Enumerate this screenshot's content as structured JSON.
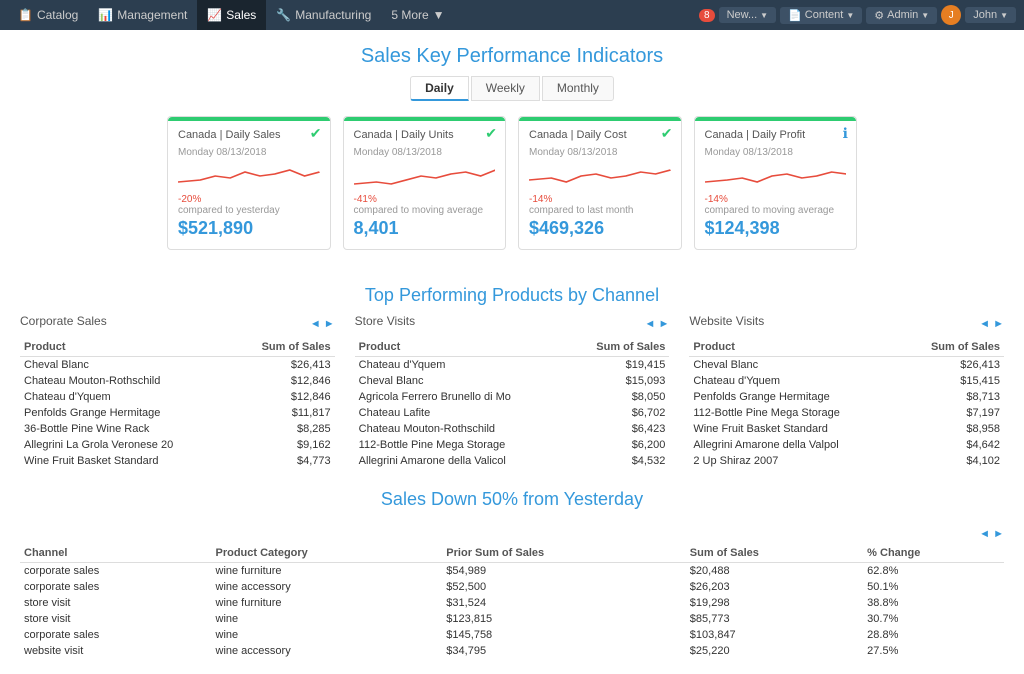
{
  "nav": {
    "items": [
      {
        "label": "Catalog",
        "icon": "📋",
        "active": false
      },
      {
        "label": "Management",
        "icon": "📊",
        "active": false
      },
      {
        "label": "Sales",
        "icon": "📈",
        "active": true
      },
      {
        "label": "Manufacturing",
        "icon": "🔧",
        "active": false
      },
      {
        "label": "5 More",
        "icon": "",
        "active": false
      }
    ],
    "right": {
      "badge": "8",
      "new_label": "New...",
      "content_label": "Content",
      "admin_label": "Admin",
      "user_label": "John"
    }
  },
  "kpi": {
    "title": "Sales Key Performance Indicators",
    "tabs": [
      "Daily",
      "Weekly",
      "Monthly"
    ],
    "active_tab": "Daily",
    "cards": [
      {
        "bar_color": "green",
        "status": "green",
        "label": "Canada | Daily Sales",
        "date": "Monday 08/13/2018",
        "change": "-20%",
        "change_label": "compared to yesterday",
        "value": "$521,890"
      },
      {
        "bar_color": "green",
        "status": "green",
        "label": "Canada | Daily Units",
        "date": "Monday 08/13/2018",
        "change": "-41%",
        "change_label": "compared to moving average",
        "value": "8,401"
      },
      {
        "bar_color": "green",
        "status": "green",
        "label": "Canada | Daily Cost",
        "date": "Monday 08/13/2018",
        "change": "-14%",
        "change_label": "compared to last month",
        "value": "$469,326"
      },
      {
        "bar_color": "green",
        "status": "info",
        "label": "Canada | Daily Profit",
        "date": "Monday 08/13/2018",
        "change": "-14%",
        "change_label": "compared to moving average",
        "value": "$124,398"
      }
    ]
  },
  "top_products": {
    "title": "Top Performing Products by Channel",
    "tables": [
      {
        "channel": "Corporate Sales",
        "col1": "Product",
        "col2": "Sum of Sales",
        "rows": [
          [
            "Cheval Blanc",
            "$26,413"
          ],
          [
            "Chateau Mouton-Rothschild",
            "$12,846"
          ],
          [
            "Chateau d'Yquem",
            "$12,846"
          ],
          [
            "Penfolds Grange Hermitage",
            "$11,817"
          ],
          [
            "36-Bottle Pine Wine Rack",
            "$8,285"
          ],
          [
            "Allegrini La Grola Veronese 20",
            "$9,162"
          ],
          [
            "Wine Fruit Basket Standard",
            "$4,773"
          ]
        ]
      },
      {
        "channel": "Store Visits",
        "col1": "Product",
        "col2": "Sum of Sales",
        "rows": [
          [
            "Chateau d'Yquem",
            "$19,415"
          ],
          [
            "Cheval Blanc",
            "$15,093"
          ],
          [
            "Agricola Ferrero Brunello di Mo",
            "$8,050"
          ],
          [
            "Chateau Lafite",
            "$6,702"
          ],
          [
            "Chateau Mouton-Rothschild",
            "$6,423"
          ],
          [
            "112-Bottle Pine Mega Storage",
            "$6,200"
          ],
          [
            "Allegrini Amarone della Valicol",
            "$4,532"
          ]
        ]
      },
      {
        "channel": "Website Visits",
        "col1": "Product",
        "col2": "Sum of Sales",
        "rows": [
          [
            "Cheval Blanc",
            "$26,413"
          ],
          [
            "Chateau d'Yquem",
            "$15,415"
          ],
          [
            "Penfolds Grange Hermitage",
            "$8,713"
          ],
          [
            "112-Bottle Pine Mega Storage",
            "$7,197"
          ],
          [
            "Wine Fruit Basket Standard",
            "$8,958"
          ],
          [
            "Allegrini Amarone della Valpol",
            "$4,642"
          ],
          [
            "2 Up Shiraz 2007",
            "$4,102"
          ]
        ]
      }
    ]
  },
  "sales_down": {
    "title": "Sales Down 50% from Yesterday",
    "col_headers": [
      "Channel",
      "Product Category",
      "Prior Sum of Sales",
      "Sum of Sales",
      "% Change"
    ],
    "rows": [
      [
        "corporate sales",
        "wine furniture",
        "$54,989",
        "$20,488",
        "62.8%"
      ],
      [
        "corporate sales",
        "wine accessory",
        "$52,500",
        "$26,203",
        "50.1%"
      ],
      [
        "store visit",
        "wine furniture",
        "$31,524",
        "$19,298",
        "38.8%"
      ],
      [
        "store visit",
        "wine",
        "$123,815",
        "$85,773",
        "30.7%"
      ],
      [
        "corporate sales",
        "wine",
        "$145,758",
        "$103,847",
        "28.8%"
      ],
      [
        "website visit",
        "wine accessory",
        "$34,795",
        "$25,220",
        "27.5%"
      ]
    ]
  }
}
